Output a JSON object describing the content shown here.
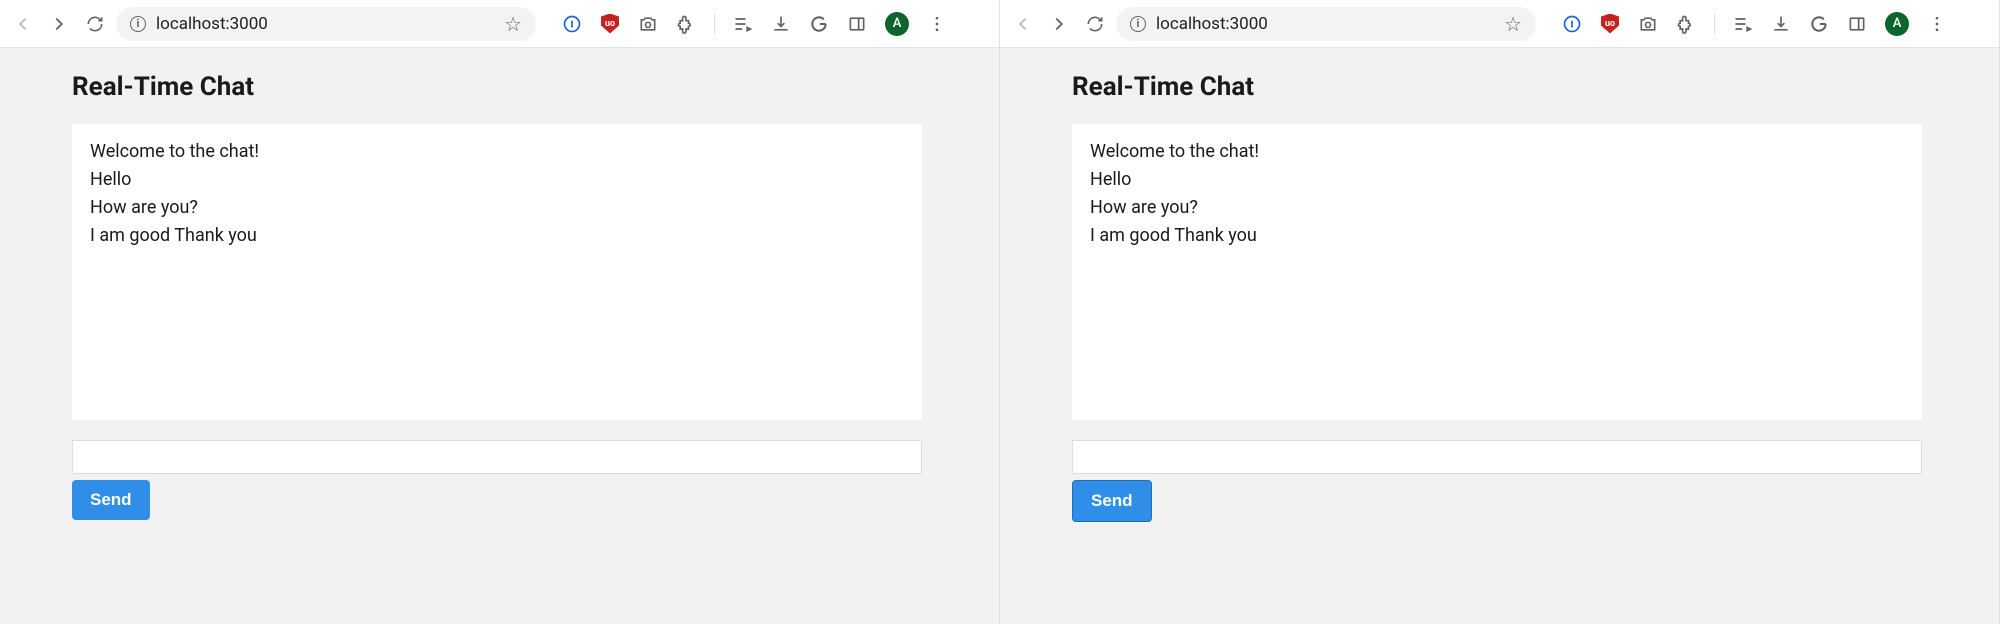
{
  "windows": [
    {
      "url": "localhost:3000",
      "avatar_letter": "A",
      "page_title": "Real-Time Chat",
      "messages": [
        "Welcome to the chat!",
        "Hello",
        "How are you?",
        "I am good Thank you"
      ],
      "input_value": "",
      "send_label": "Send",
      "send_bordered": false
    },
    {
      "url": "localhost:3000",
      "avatar_letter": "A",
      "page_title": "Real-Time Chat",
      "messages": [
        "Welcome to the chat!",
        "Hello",
        "How are you?",
        "I am good Thank you"
      ],
      "input_value": "",
      "send_label": "Send",
      "send_bordered": true
    }
  ]
}
